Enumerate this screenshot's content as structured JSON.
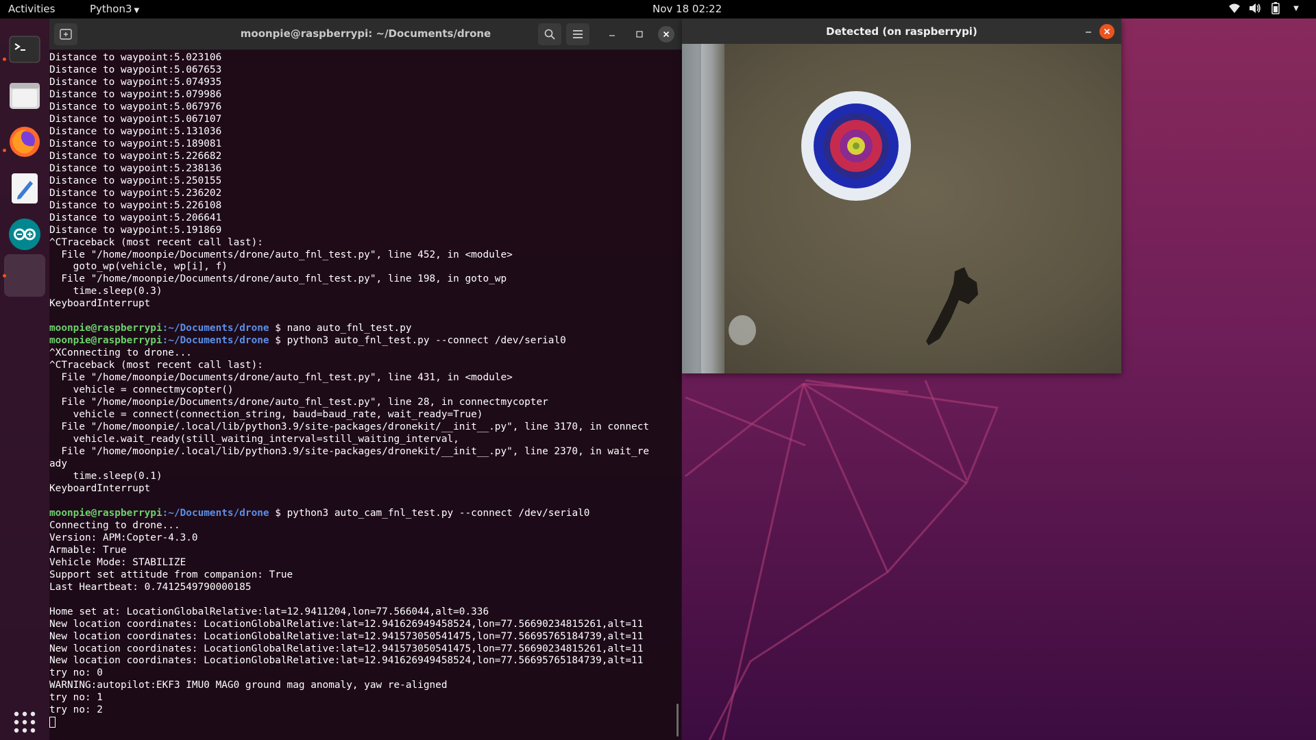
{
  "topbar": {
    "activities": "Activities",
    "app_menu": "Python3",
    "clock": "Nov 18  02:22",
    "tray_icons": [
      "wifi-icon",
      "volume-icon",
      "battery-icon",
      "power-menu-caret-icon"
    ]
  },
  "dock": {
    "items": [
      {
        "name": "terminal-icon",
        "running": true,
        "active": false
      },
      {
        "name": "files-icon",
        "running": false,
        "active": false
      },
      {
        "name": "firefox-icon",
        "running": true,
        "active": false
      },
      {
        "name": "text-editor-icon",
        "running": false,
        "active": false
      },
      {
        "name": "arduino-icon",
        "running": false,
        "active": false
      },
      {
        "name": "python-window-icon",
        "running": true,
        "active": true
      }
    ],
    "show_apps_icon": "grid-icon"
  },
  "terminal": {
    "title": "moonpie@raspberrypi: ~/Documents/drone",
    "prompt_user": "moonpie@raspberrypi",
    "prompt_path": ":~/Documents/drone",
    "prompt_symbol": " $ ",
    "lines": [
      {
        "t": "Distance to waypoint:5.023106"
      },
      {
        "t": "Distance to waypoint:5.067653"
      },
      {
        "t": "Distance to waypoint:5.074935"
      },
      {
        "t": "Distance to waypoint:5.079986"
      },
      {
        "t": "Distance to waypoint:5.067976"
      },
      {
        "t": "Distance to waypoint:5.067107"
      },
      {
        "t": "Distance to waypoint:5.131036"
      },
      {
        "t": "Distance to waypoint:5.189081"
      },
      {
        "t": "Distance to waypoint:5.226682"
      },
      {
        "t": "Distance to waypoint:5.238136"
      },
      {
        "t": "Distance to waypoint:5.250155"
      },
      {
        "t": "Distance to waypoint:5.236202"
      },
      {
        "t": "Distance to waypoint:5.226108"
      },
      {
        "t": "Distance to waypoint:5.206641"
      },
      {
        "t": "Distance to waypoint:5.191869"
      },
      {
        "t": "^CTraceback (most recent call last):"
      },
      {
        "t": "  File \"/home/moonpie/Documents/drone/auto_fnl_test.py\", line 452, in <module>"
      },
      {
        "t": "    goto_wp(vehicle, wp[i], f)"
      },
      {
        "t": "  File \"/home/moonpie/Documents/drone/auto_fnl_test.py\", line 198, in goto_wp"
      },
      {
        "t": "    time.sleep(0.3)"
      },
      {
        "t": "KeyboardInterrupt"
      },
      {
        "t": ""
      },
      {
        "prompt": true,
        "cmd": "nano auto_fnl_test.py"
      },
      {
        "prompt": true,
        "cmd": "python3 auto_fnl_test.py --connect /dev/serial0"
      },
      {
        "t": "^XConnecting to drone..."
      },
      {
        "t": "^CTraceback (most recent call last):"
      },
      {
        "t": "  File \"/home/moonpie/Documents/drone/auto_fnl_test.py\", line 431, in <module>"
      },
      {
        "t": "    vehicle = connectmycopter()"
      },
      {
        "t": "  File \"/home/moonpie/Documents/drone/auto_fnl_test.py\", line 28, in connectmycopter"
      },
      {
        "t": "    vehicle = connect(connection_string, baud=baud_rate, wait_ready=True)"
      },
      {
        "t": "  File \"/home/moonpie/.local/lib/python3.9/site-packages/dronekit/__init__.py\", line 3170, in connect"
      },
      {
        "t": "    vehicle.wait_ready(still_waiting_interval=still_waiting_interval,"
      },
      {
        "t": "  File \"/home/moonpie/.local/lib/python3.9/site-packages/dronekit/__init__.py\", line 2370, in wait_re"
      },
      {
        "t": "ady"
      },
      {
        "t": "    time.sleep(0.1)"
      },
      {
        "t": "KeyboardInterrupt"
      },
      {
        "t": ""
      },
      {
        "prompt": true,
        "cmd": "python3 auto_cam_fnl_test.py --connect /dev/serial0"
      },
      {
        "t": "Connecting to drone..."
      },
      {
        "t": "Version: APM:Copter-4.3.0"
      },
      {
        "t": "Armable: True"
      },
      {
        "t": "Vehicle Mode: STABILIZE"
      },
      {
        "t": "Support set attitude from companion: True"
      },
      {
        "t": "Last Heartbeat: 0.7412549790000185"
      },
      {
        "t": ""
      },
      {
        "t": "Home set at: LocationGlobalRelative:lat=12.9411204,lon=77.566044,alt=0.336"
      },
      {
        "t": "New location coordinates: LocationGlobalRelative:lat=12.941626949458524,lon=77.56690234815261,alt=11"
      },
      {
        "t": "New location coordinates: LocationGlobalRelative:lat=12.941573050541475,lon=77.56695765184739,alt=11"
      },
      {
        "t": "New location coordinates: LocationGlobalRelative:lat=12.941573050541475,lon=77.56690234815261,alt=11"
      },
      {
        "t": "New location coordinates: LocationGlobalRelative:lat=12.941626949458524,lon=77.56695765184739,alt=11"
      },
      {
        "t": "try no: 0"
      },
      {
        "t": "WARNING:autopilot:EKF3 IMU0 MAG0 ground mag anomaly, yaw re-aligned"
      },
      {
        "t": "try no: 1"
      },
      {
        "t": "try no: 2"
      },
      {
        "cursor": true
      }
    ]
  },
  "camera_window": {
    "title": "Detected (on raspberrypi)"
  },
  "colors": {
    "accent": "#e95420",
    "prompt_user": "#6cd16c",
    "prompt_path": "#5b8fe8"
  }
}
